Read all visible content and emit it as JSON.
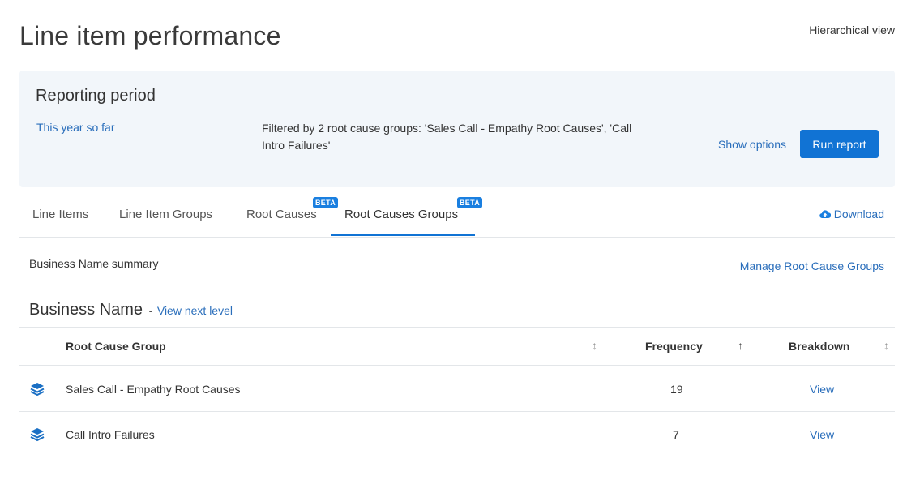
{
  "page": {
    "title": "Line item performance",
    "hierarchical_view": "Hierarchical view"
  },
  "reporting": {
    "title": "Reporting period",
    "period": "This year so far",
    "filter_text": "Filtered by 2 root cause groups: 'Sales Call - Empathy Root Causes', 'Call Intro Failures'",
    "show_options": "Show options",
    "run_report": "Run report"
  },
  "tabs": {
    "items": [
      {
        "label": "Line Items"
      },
      {
        "label": "Line Item Groups"
      },
      {
        "label": "Root Causes",
        "badge": "BETA"
      },
      {
        "label": "Root Causes Groups",
        "badge": "BETA",
        "active": true
      }
    ],
    "download": "Download"
  },
  "summary": {
    "label": "Business Name summary",
    "manage": "Manage Root Cause Groups"
  },
  "level": {
    "title": "Business Name",
    "separator": "-",
    "next_level": "View next level"
  },
  "table": {
    "columns": [
      "Root Cause Group",
      "Frequency",
      "Breakdown"
    ],
    "sort_indicators": [
      "↕",
      "↑",
      "↕"
    ],
    "rows": [
      {
        "icon": "layers-icon",
        "group": "Sales Call - Empathy Root Causes",
        "frequency": "19",
        "breakdown": "View"
      },
      {
        "icon": "layers-icon",
        "group": "Call Intro Failures",
        "frequency": "7",
        "breakdown": "View"
      }
    ]
  },
  "colors": {
    "accent": "#1173d4",
    "link": "#2a6ebb",
    "panel_bg": "#f2f6fa",
    "badge": "#1a7fe0"
  }
}
